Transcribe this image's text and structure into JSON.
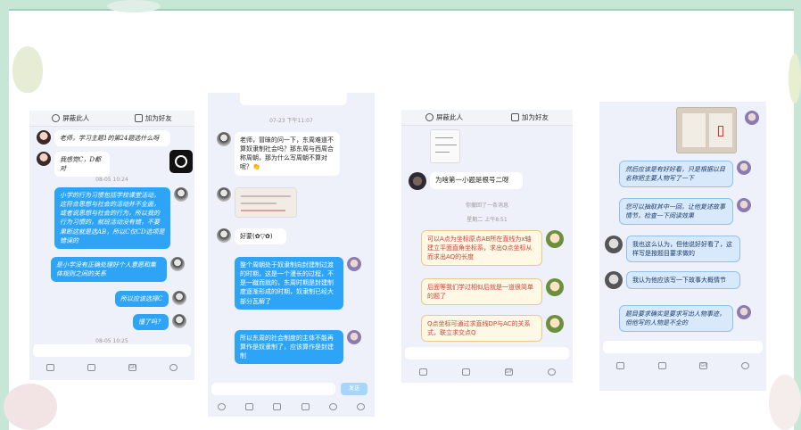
{
  "theme": {
    "accent": "#2da4f5",
    "frame": "#c8e6d6",
    "cream_border": "#e9c98a",
    "cream_text": "#c0463a"
  },
  "screens": [
    {
      "topbar": {
        "block_label": "屏蔽此人",
        "add_friend_label": "加为好友"
      },
      "messages": [
        {
          "side": "left",
          "text": "老师，学习主题1的第24题选什么呀"
        },
        {
          "side": "left",
          "text": "我感觉C，D都对"
        }
      ],
      "timestamp": "08-05 10:24",
      "replies": [
        {
          "side": "right",
          "text": "小学的行为习惯包括学校课堂活动，这符合思想与社会的活动并不全面，或者说思想与社会的行为，所以我的行为习惯的，就班活动没有错，不要果断这就是选AB，所以C仅CD选项是错误的"
        },
        {
          "side": "right",
          "text": "是小学没有正确处理好个人意愿和集体规则之间的关系"
        },
        {
          "side": "right",
          "text": "所以应该选择C"
        },
        {
          "side": "right",
          "text": "懂了吗？"
        }
      ],
      "footer_timestamp": "08-05 10:25"
    },
    {
      "partial_time": "07-23 下午11:07",
      "messages": [
        {
          "side": "left",
          "text": "老师，冒昧的问一下，东周难道不算奴隶制社会吗？那东周与西周合称周朝，那为什么写周朝不算对呢？👏"
        },
        {
          "side": "left",
          "text": "好蒙(✿▽✿)"
        }
      ],
      "replies": [
        {
          "side": "right",
          "text": "整个周朝处于奴隶制向封建制过渡的时期，这是一个漫长的过程，不是一蹴而就的，东周时期是封建制度逐渐形成的时期，奴隶制已经大部分瓦解了"
        },
        {
          "side": "right",
          "text": "所以东周的社会制度的主体不能再算作是奴隶制了，应该算作是封建制"
        }
      ],
      "send_label": "发送"
    },
    {
      "topbar": {
        "block_label": "屏蔽此人",
        "add_friend_label": "加为好友"
      },
      "messages": [
        {
          "side": "left",
          "text": "为啥第一小题是根号二呀"
        }
      ],
      "recall_notice": "你撤回了一条消息",
      "timestamp": "星期二 上午8:51",
      "replies": [
        {
          "side": "right",
          "text": "可以A点为坐标原点AB所在直线为x轴建立平面直角坐标系，求出Q点坐标从而求出AQ的长度"
        },
        {
          "side": "right",
          "text": "后面等我们学过相似后就是一道很简单的题了"
        },
        {
          "side": "right",
          "text": "Q点坐标可通过求直线DP与AC的关系式，联立求交点Q"
        }
      ]
    },
    {
      "replies_top": [
        {
          "side": "right",
          "text": "然后应该是有好好看，只是根据以目名称把主要人物写了一下"
        },
        {
          "side": "right",
          "text": "您可以抽取其中一回，让他复述故事情节，检查一下阅读效果"
        }
      ],
      "messages": [
        {
          "side": "left",
          "text": "我也这么认为，但他说好好看了，这样写是按题目要求做的"
        },
        {
          "side": "left",
          "text": "我认为他应该写一下故事大概情节"
        }
      ],
      "replies_bottom": [
        {
          "side": "right",
          "text": "题目要求确实是要求写出人物事迹，但他写的人物是不全的"
        }
      ]
    }
  ]
}
